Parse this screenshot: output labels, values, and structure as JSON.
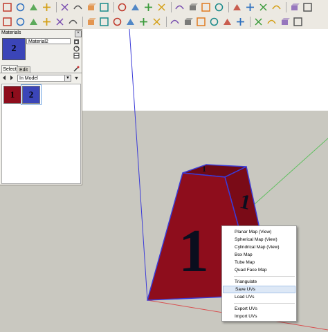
{
  "toolbar": {
    "row1_icons": [
      "select-icon",
      "make-component-icon",
      "eraser-icon",
      "paint-bucket-icon",
      "rectangle-icon",
      "circle-icon",
      "polygon-icon",
      "arc-icon",
      "freehand-icon",
      "move-icon",
      "push-pull-icon",
      "rotate-icon",
      "follow-me-icon",
      "scale-icon",
      "offset-icon",
      "tape-measure-icon",
      "dimension-icon",
      "protractor-icon",
      "text-icon",
      "axes-icon",
      "3d-text-icon",
      "orbit-icon",
      "pan-icon",
      "zoom-icon",
      "zoom-window-icon",
      "zoom-extents-icon",
      "previous-view-icon",
      "next-view-icon",
      "walk-icon",
      "look-around-icon",
      "position-camera-icon",
      "section-plane-icon"
    ],
    "row2_icons": [
      "iso-view-icon",
      "top-view-icon",
      "front-view-icon",
      "right-view-icon",
      "back-view-icon",
      "left-view-icon",
      "xray-icon",
      "wireframe-icon",
      "hidden-line-icon",
      "shaded-icon",
      "textured-icon",
      "monochrome-icon",
      "sandbox-from-contours-icon",
      "sandbox-from-scratch-icon",
      "smoove-icon",
      "stamp-icon",
      "drape-icon",
      "add-detail-icon",
      "flip-edge-icon",
      "scale-figure-icon",
      "solid-union-icon",
      "solid-subtract-icon",
      "solid-trim-icon",
      "solid-split-icon",
      "color-picker-icon",
      "cube-ruby-icon",
      "cube-ruby-2-icon"
    ]
  },
  "materials_panel": {
    "title": "Materials",
    "close_glyph": "×",
    "current_material": {
      "name": "Material2",
      "glyph": "2",
      "color": "#3b45b8"
    },
    "tabs": {
      "select": "Select",
      "edit": "Edit"
    },
    "collection": "In Model",
    "swatches": [
      {
        "glyph": "1",
        "color": "#8e0d1c",
        "selected": false
      },
      {
        "glyph": "2",
        "color": "#3b45b8",
        "selected": true
      }
    ]
  },
  "context_menu": {
    "groups": [
      [
        "Planar Map (View)",
        "Spherical Map (View)",
        "Cylindrical Map (View)",
        "Box Map",
        "Tube Map",
        "Quad Face Map"
      ],
      [
        "Triangulate",
        "Save UVs",
        "Load UVs"
      ],
      [
        "Export UVs",
        "Import UVs"
      ]
    ],
    "highlighted": "Save UVs"
  },
  "scene": {
    "object_face_label": "1",
    "object_color": "#8e0d1c",
    "edge_color": "#3b3bd8",
    "axis_colors": {
      "blue": "#3b3bd8",
      "green": "#5fbf5f",
      "red": "#d85050"
    },
    "sky_color": "#ffffff",
    "ground_color": "#c9c8c0"
  }
}
